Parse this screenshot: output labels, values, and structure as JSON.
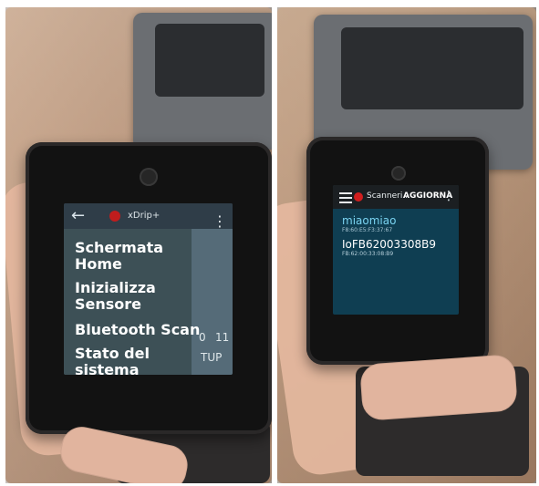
{
  "left_screen": {
    "app_title": "xDrip+",
    "menu_items": [
      "Schermata Home",
      "Inizializza Sensore",
      "Bluetooth Scan",
      "Stato del sistema"
    ],
    "background_fragments": [
      "0",
      "11",
      "TUP"
    ]
  },
  "right_screen": {
    "title": "Scanneri..",
    "refresh_label": "AGGIORNA",
    "devices": [
      {
        "name": "miaomiao",
        "address": "F8:60:E5:F3:37:67"
      },
      {
        "name": "IoFB62003308B9",
        "address": "FB:62:00:33:08:B9"
      }
    ]
  },
  "colors": {
    "accent_blue": "#7ad3f1",
    "app_red": "#c01d1d",
    "screen_bg_right": "#0f3e52",
    "screen_bg_left": "#3b4b57"
  },
  "icons": {
    "left_back": "back-arrow-icon",
    "left_more": "more-vertical-icon",
    "right_menu": "hamburger-icon",
    "right_more": "more-vertical-icon"
  }
}
